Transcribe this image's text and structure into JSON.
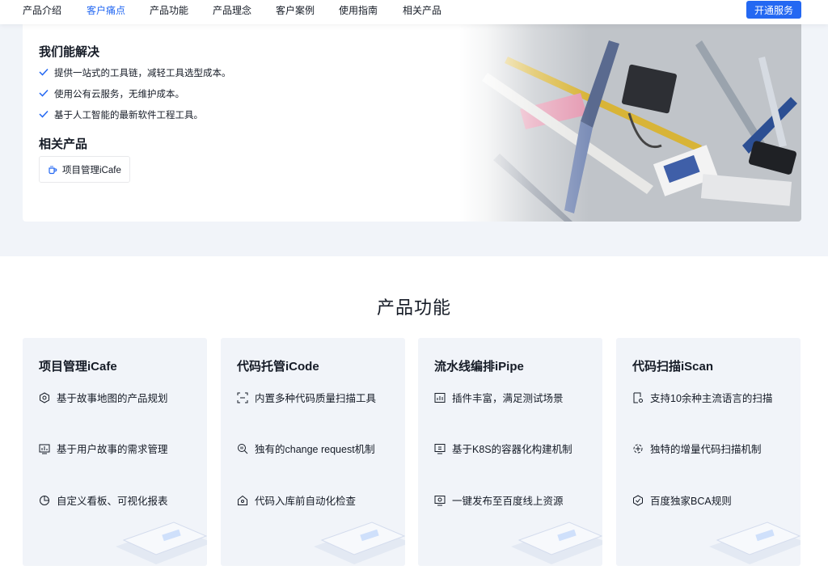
{
  "nav": {
    "tabs": [
      {
        "label": "产品介绍"
      },
      {
        "label": "客户痛点"
      },
      {
        "label": "产品功能"
      },
      {
        "label": "产品理念"
      },
      {
        "label": "客户案例"
      },
      {
        "label": "使用指南"
      },
      {
        "label": "相关产品"
      }
    ],
    "active_tab": "客户痛点",
    "cta_label": "开通服务"
  },
  "pain": {
    "solve_heading": "我们能解决",
    "solve_items": [
      "提供一站式的工具链，减轻工具选型成本。",
      "使用公有云服务，无维护成本。",
      "基于人工智能的最新软件工程工具。"
    ],
    "related_heading": "相关产品",
    "related_product": "项目管理iCafe"
  },
  "features": {
    "title": "产品功能",
    "cards": [
      {
        "name": "项目管理iCafe",
        "items": [
          {
            "icon": "target-icon",
            "text": "基于故事地图的产品规划"
          },
          {
            "icon": "monitor-chart-icon",
            "text": "基于用户故事的需求管理"
          },
          {
            "icon": "pie-chart-icon",
            "text": "自定义看板、可视化报表"
          }
        ]
      },
      {
        "name": "代码托管iCode",
        "items": [
          {
            "icon": "scan-frame-icon",
            "text": "内置多种代码质量扫描工具"
          },
          {
            "icon": "code-search-icon",
            "text": "独有的change request机制"
          },
          {
            "icon": "house-check-icon",
            "text": "代码入库前自动化检查"
          }
        ]
      },
      {
        "name": "流水线编排iPipe",
        "items": [
          {
            "icon": "plugin-chart-icon",
            "text": "插件丰富，满足测试场景"
          },
          {
            "icon": "container-icon",
            "text": "基于K8S的容器化构建机制"
          },
          {
            "icon": "deploy-icon",
            "text": "一键发布至百度线上资源"
          }
        ]
      },
      {
        "name": "代码扫描iScan",
        "items": [
          {
            "icon": "doc-scan-icon",
            "text": "支持10余种主流语言的扫描"
          },
          {
            "icon": "incremental-icon",
            "text": "独特的增量代码扫描机制"
          },
          {
            "icon": "rules-icon",
            "text": "百度独家BCA规则"
          }
        ]
      }
    ]
  },
  "colors": {
    "accent": "#2468f2",
    "section_bg": "#f1f4f9",
    "text": "#151b26"
  }
}
